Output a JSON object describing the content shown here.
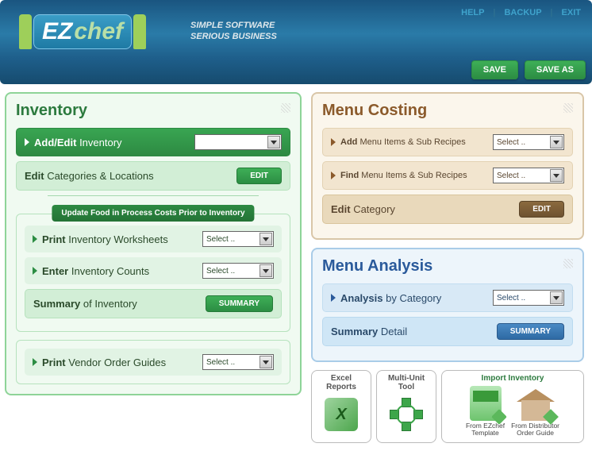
{
  "header": {
    "logo_ez": "EZ",
    "logo_chef": "chef",
    "tagline1": "SIMPLE SOFTWARE",
    "tagline2": "SERIOUS BUSINESS",
    "links": {
      "help": "HELP",
      "backup": "BACKUP",
      "exit": "EXIT"
    },
    "save": "SAVE",
    "save_as": "SAVE AS"
  },
  "select_placeholder": "Select ..",
  "inventory": {
    "title": "Inventory",
    "add_edit_bold": "Add/Edit",
    "add_edit_rest": "Inventory",
    "edit_cat_bold": "Edit",
    "edit_cat_rest": "Categories & Locations",
    "edit_btn": "EDIT",
    "update_header": "Update Food in Process Costs Prior to Inventory",
    "print_ws_bold": "Print",
    "print_ws_rest": "Inventory Worksheets",
    "enter_bold": "Enter",
    "enter_rest": "Inventory Counts",
    "summary_bold": "Summary",
    "summary_rest": "of Inventory",
    "summary_btn": "SUMMARY",
    "print_vendor_bold": "Print",
    "print_vendor_rest": "Vendor Order Guides"
  },
  "costing": {
    "title": "Menu Costing",
    "add_bold": "Add",
    "add_rest": "Menu Items & Sub Recipes",
    "find_bold": "Find",
    "find_rest": "Menu Items & Sub Recipes",
    "edit_cat_bold": "Edit",
    "edit_cat_rest": "Category",
    "edit_btn": "EDIT"
  },
  "analysis": {
    "title": "Menu Analysis",
    "analysis_bold": "Analysis",
    "analysis_rest": "by Category",
    "summary_bold": "Summary",
    "summary_rest": "Detail",
    "summary_btn": "SUMMARY"
  },
  "tiles": {
    "excel1": "Excel",
    "excel2": "Reports",
    "multi1": "Multi-Unit",
    "multi2": "Tool",
    "import_title": "Import Inventory",
    "template1": "From EZchef",
    "template2": "Template",
    "dist1": "From Distributor",
    "dist2": "Order Guide"
  }
}
